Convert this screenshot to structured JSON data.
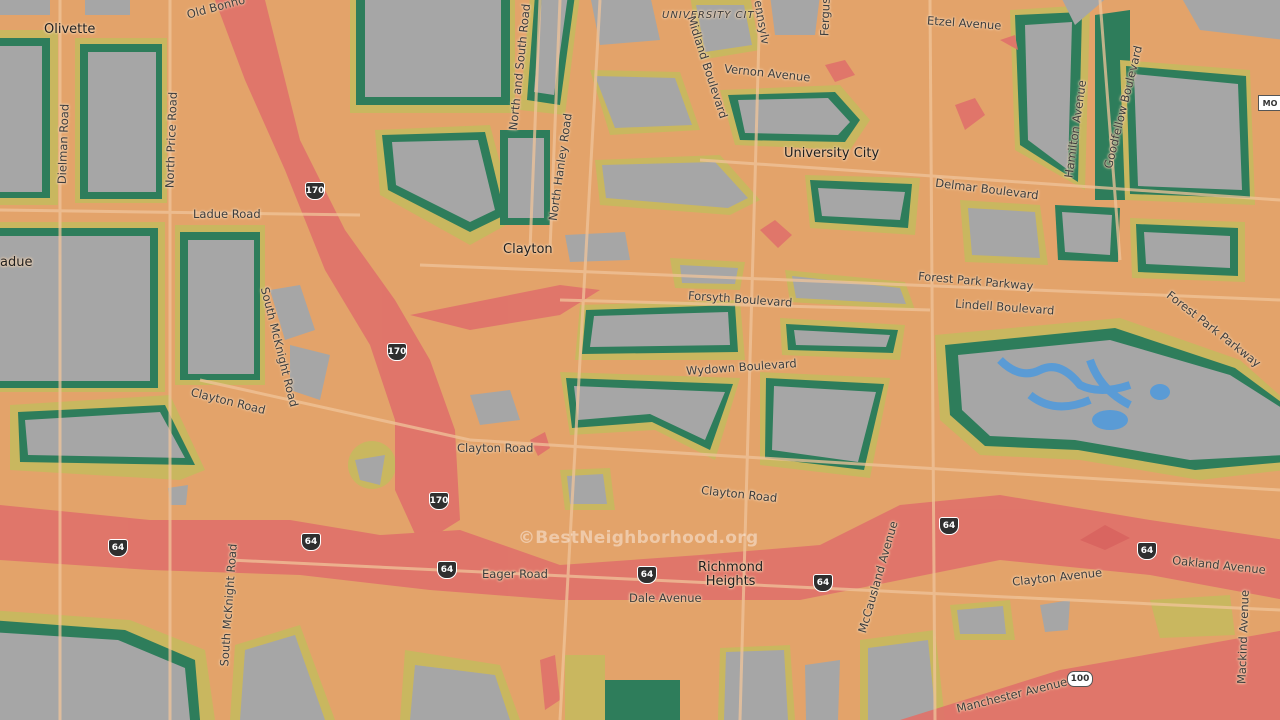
{
  "map": {
    "watermark": "©BestNeighborhood.org",
    "colors": {
      "low": "#2e7d5b",
      "low_mid": "#7fa257",
      "mid": "#c9b75f",
      "mid_high": "#e3a36a",
      "high": "#e0726a",
      "urban_block": "#a6a6a6",
      "water": "#5a9bd5"
    },
    "places": {
      "olivette": "Olivette",
      "university_city_small": "UNIVERSITY CITY",
      "university_city": "University City",
      "clayton": "Clayton",
      "richmond_heights": "Richmond\nHeights",
      "ladue": "adue"
    },
    "roads": {
      "old_bonhomme": "Old Bonho",
      "etzel_avenue": "Etzel Avenue",
      "vernon_avenue": "Vernon Avenue",
      "midland_boulevard": "Midland Boulevard",
      "pennsylvania": "Pennsylv",
      "ferguson": "Fergus",
      "north_and_south_road": "North and South Road",
      "north_hanley_road": "North Hanley Road",
      "north_price_road": "North Price Road",
      "dielman_road": "Dielman Road",
      "ladue_road": "Ladue Road",
      "south_mcknight_road_1": "South McKnight Road",
      "south_mcknight_road_2": "South McKnight Road",
      "clayton_road_1": "Clayton Road",
      "clayton_road_2": "Clayton Road",
      "clayton_road_3": "Clayton Road",
      "delmar_boulevard": "Delmar Boulevard",
      "forest_park_parkway_1": "Forest Park Parkway",
      "forest_park_parkway_2": "Forest Park Parkway",
      "forsyth_boulevard": "Forsyth Boulevard",
      "lindell_boulevard": "Lindell Boulevard",
      "wydown_boulevard": "Wydown Boulevard",
      "eager_road": "Eager Road",
      "dale_avenue": "Dale Avenue",
      "mccausland_avenue": "McCausland Avenue",
      "clayton_avenue": "Clayton Avenue",
      "oakland_avenue": "Oakland Avenue",
      "manchester_avenue": "Manchester Avenue",
      "mackind_avenue": "Mackind Avenue",
      "hamilton_avenue": "Hamilton Avenue",
      "goodfellow_boulevard": "Goodfellow Boulevard"
    },
    "shields": {
      "i170_a": "170",
      "i170_b": "170",
      "i170_c": "170",
      "i64_a": "64",
      "i64_b": "64",
      "i64_c": "64",
      "i64_d": "64",
      "i64_e": "64",
      "i64_f": "64",
      "us100": "100",
      "mo": "MO"
    }
  }
}
